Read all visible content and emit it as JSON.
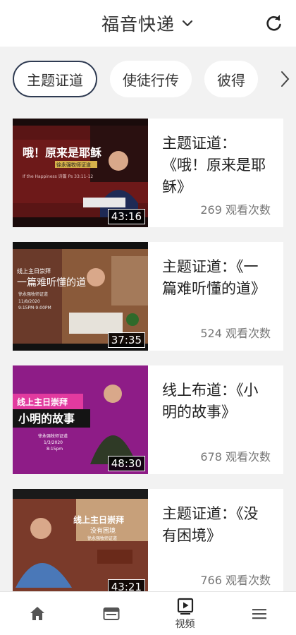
{
  "header": {
    "title": "福音快递"
  },
  "tabs": [
    {
      "label": "主题证道",
      "active": true
    },
    {
      "label": "使徒行传",
      "active": false
    },
    {
      "label": "彼得",
      "active": false
    }
  ],
  "videos": [
    {
      "title": "主题证道：《哦！原来是耶稣》",
      "views": "269 观看次数",
      "duration": "43:16",
      "thumb_text": [
        "哦！原来是耶稣",
        "徐永强牧师证道",
        "If the Happiness 诗篇 Ps 33:11-12"
      ]
    },
    {
      "title": "主题证道：《一篇难听懂的道》",
      "views": "524 观看次数",
      "duration": "37:35",
      "thumb_text": [
        "线上主日崇拜",
        "一篇难听懂的道",
        "徐永强牧师证道",
        "11/8/2020",
        "9:15PM-9:00PM"
      ]
    },
    {
      "title": "线上布道：《小明的故事》",
      "views": "678 观看次数",
      "duration": "48:30",
      "thumb_text": [
        "线上主日崇拜",
        "小明的故事",
        "徐永强牧师证道",
        "1/3/2020",
        "8:15pm"
      ]
    },
    {
      "title": "主题证道：《没有困境》",
      "views": "766 观看次数",
      "duration": "43:21",
      "thumb_text": [
        "线上主日崇拜",
        "没有困境",
        "徐永强牧师证道"
      ]
    }
  ],
  "bottom_nav": [
    {
      "icon": "home-icon",
      "label": ""
    },
    {
      "icon": "browser-icon",
      "label": ""
    },
    {
      "icon": "video-icon",
      "label": "视频"
    },
    {
      "icon": "menu-icon",
      "label": ""
    }
  ]
}
